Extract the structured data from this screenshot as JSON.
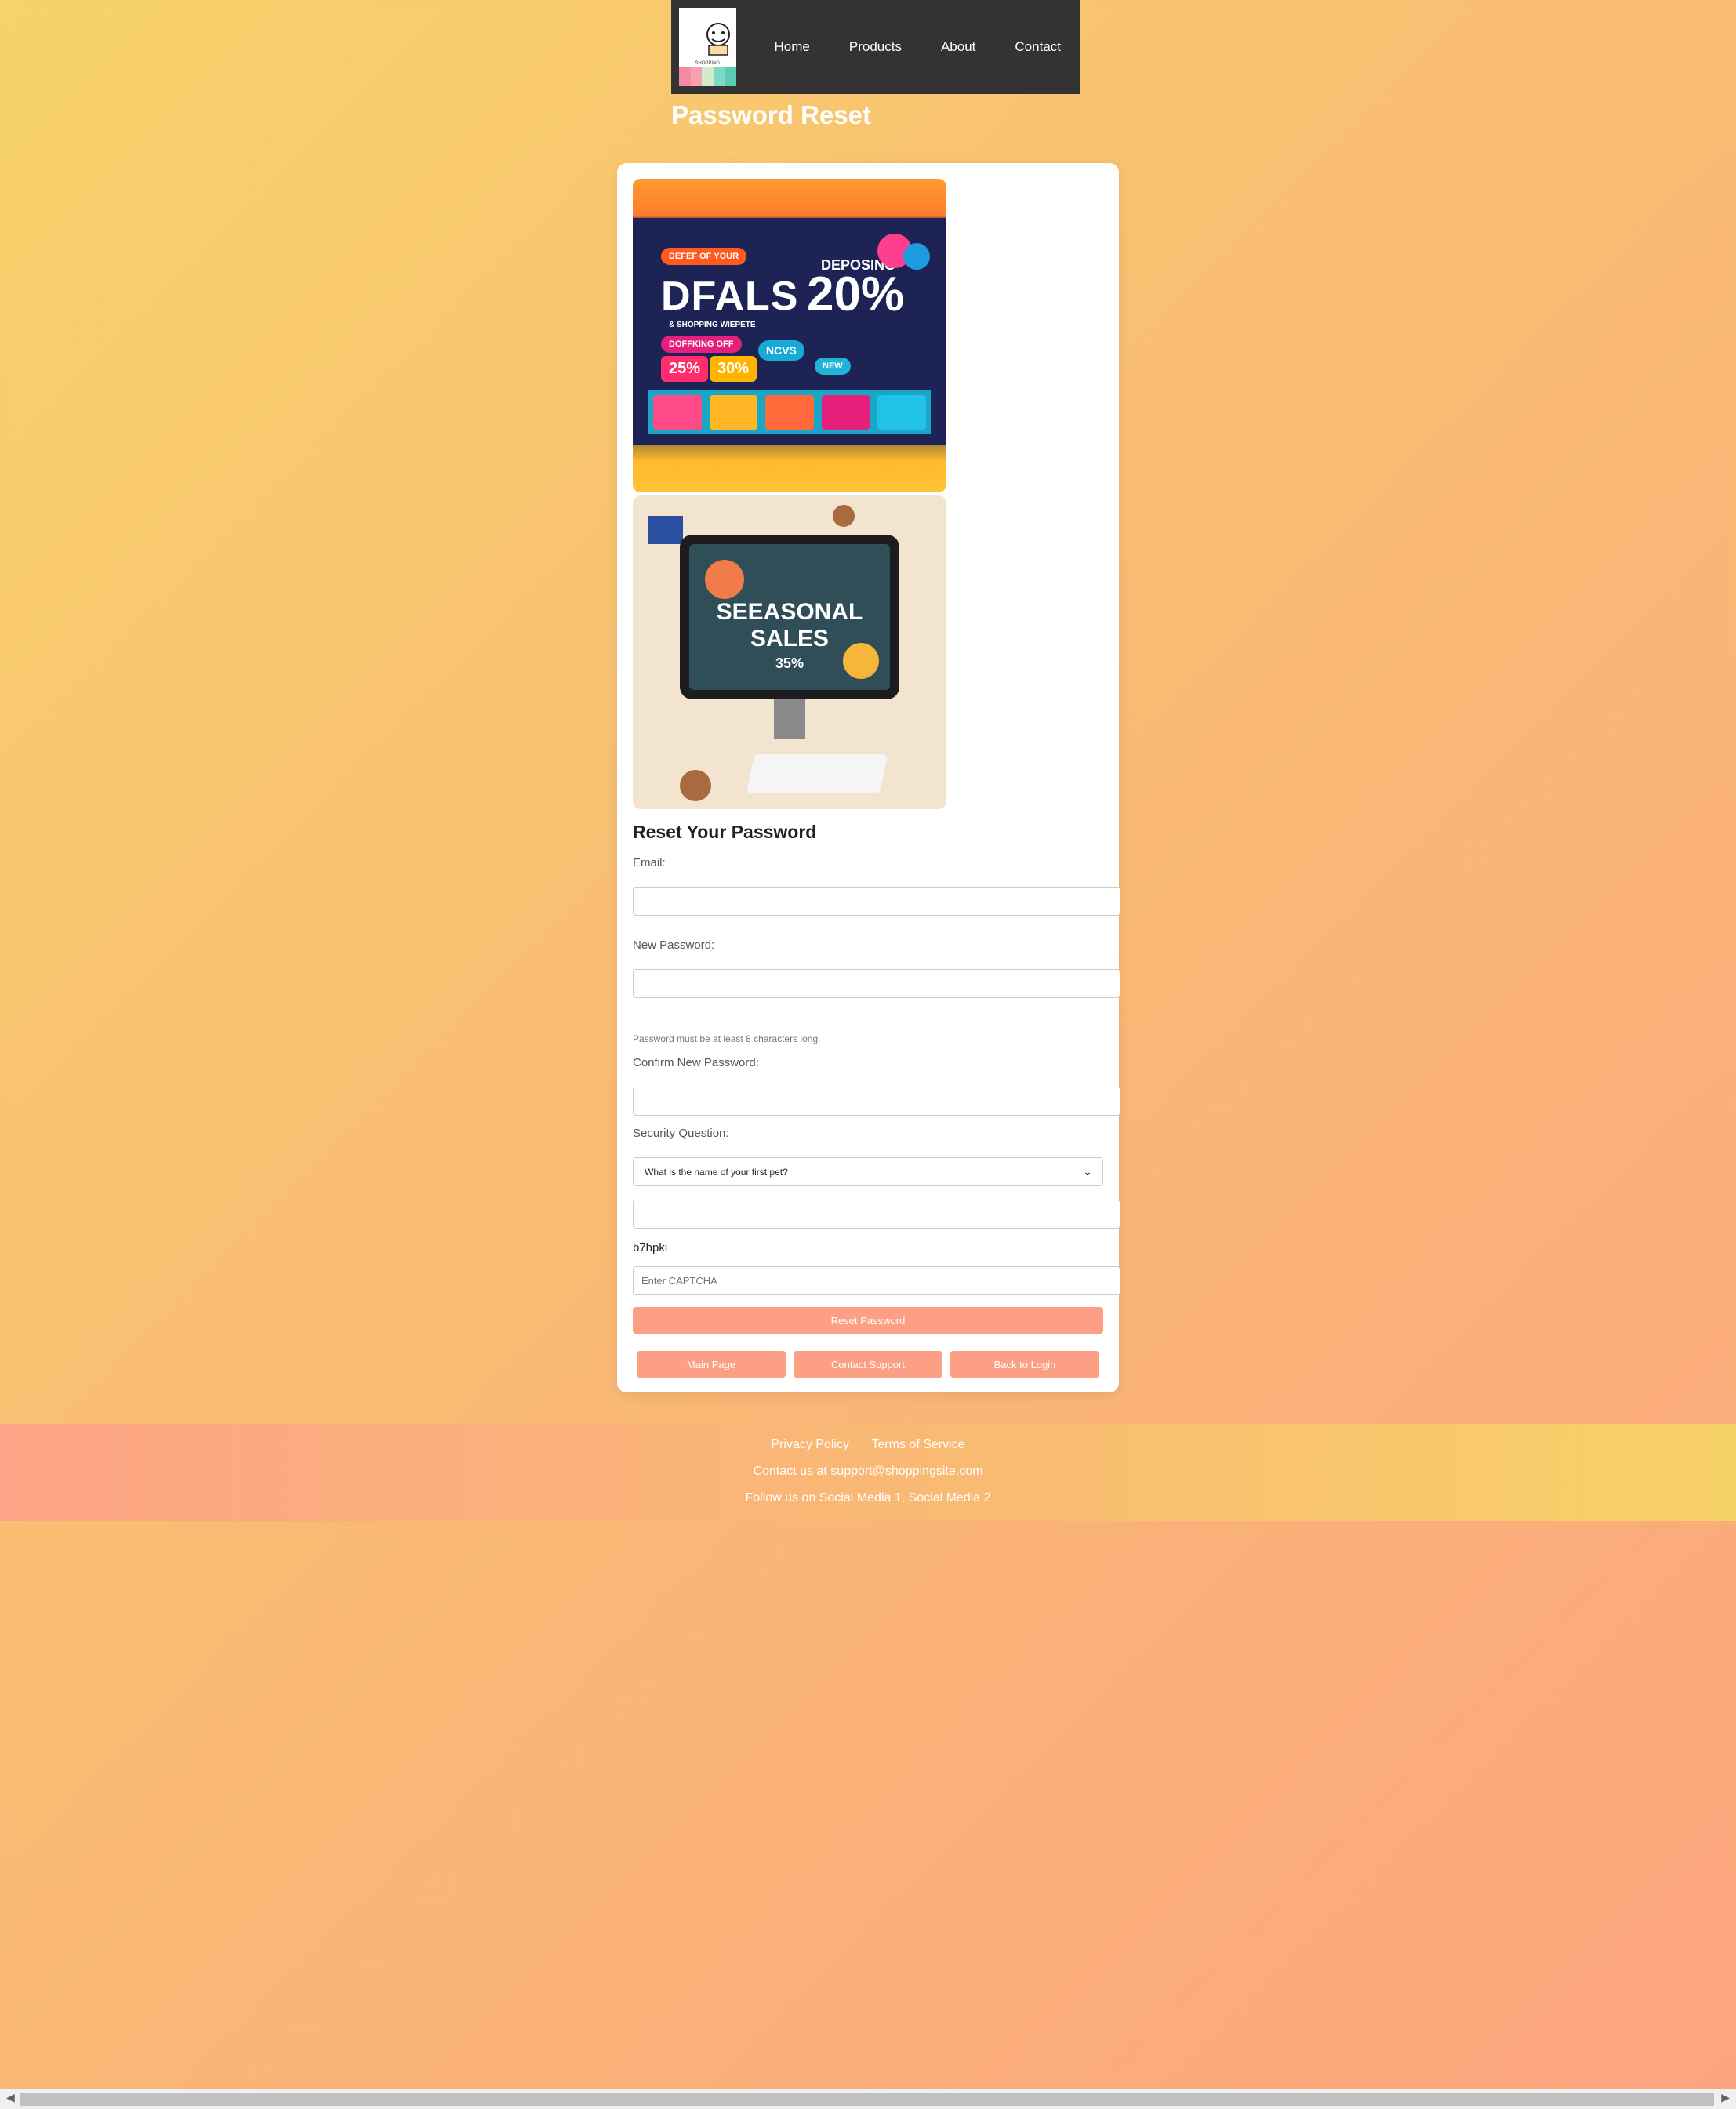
{
  "nav": {
    "logo_text": "SHOPPING",
    "items": [
      {
        "label": "Home"
      },
      {
        "label": "Products"
      },
      {
        "label": "About"
      },
      {
        "label": "Contact"
      }
    ]
  },
  "page": {
    "title": "Password Reset"
  },
  "banners": {
    "first": {
      "headline": "DFALS",
      "sub": "& SHOPPING WIEPETE",
      "top_tag": "DEFEF OF YOUR",
      "promo": "DEPOSING",
      "percent": "20%",
      "tag1": "DOFFKING OFF",
      "tag2": "NCVS",
      "tag3": "NEW",
      "badge1": "25%",
      "badge2": "30%"
    },
    "second": {
      "headline": "SEEASONAL SALES",
      "percent": "35%"
    }
  },
  "form": {
    "heading": "Reset Your Password",
    "email_label": "Email:",
    "email_value": "",
    "new_password_label": "New Password:",
    "new_password_value": "",
    "password_hint": "Password must be at least 8 characters long.",
    "confirm_label": "Confirm New Password:",
    "confirm_value": "",
    "security_label": "Security Question:",
    "security_selected": "What is the name of your first pet?",
    "security_answer": "",
    "captcha_code": "b7hpki",
    "captcha_placeholder": "Enter CAPTCHA",
    "reset_button": "Reset Password",
    "main_page_button": "Main Page",
    "contact_support_button": "Contact Support",
    "back_login_button": "Back to Login"
  },
  "footer": {
    "privacy": "Privacy Policy",
    "terms": "Terms of Service",
    "contact": "Contact us at support@shoppingsite.com",
    "social": "Follow us on Social Media 1, Social Media 2"
  },
  "colors": {
    "accent": "#fc9f85",
    "nav_bg": "#333333",
    "bg_start": "#f7d36a",
    "bg_end": "#fca47f"
  }
}
